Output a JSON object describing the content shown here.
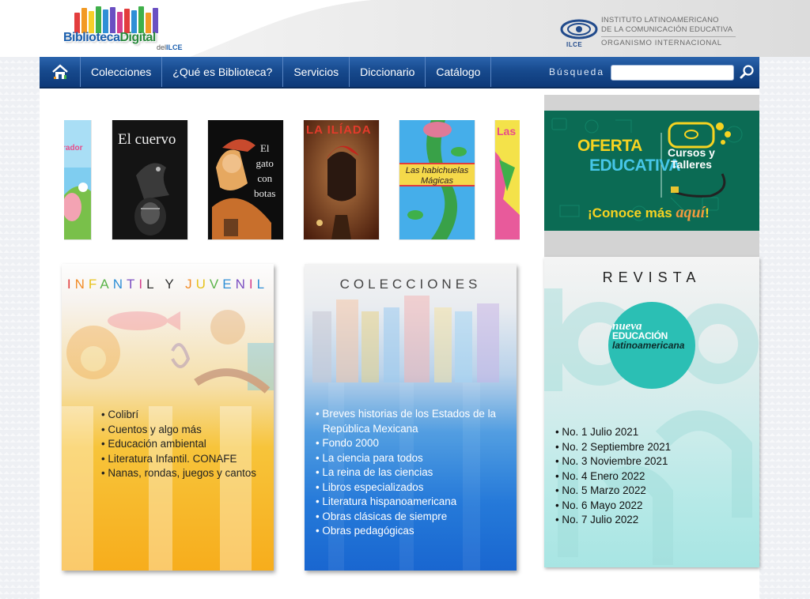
{
  "header": {
    "logo": {
      "word1": "Biblioteca",
      "word2": "Digital",
      "sub_prefix": "del",
      "sub_org": "ILCE"
    },
    "institute": {
      "abbr": "ILCE",
      "line1": "INSTITUTO LATINOAMERICANO",
      "line2": "DE LA COMUNICACIÓN EDUCATIVA",
      "line3": "ORGANISMO INTERNACIONAL"
    }
  },
  "nav": {
    "home_icon": "home-icon",
    "items": [
      {
        "label": "Colecciones"
      },
      {
        "label": "¿Qué es Biblioteca?"
      },
      {
        "label": "Servicios"
      },
      {
        "label": "Diccionario"
      },
      {
        "label": "Catálogo"
      }
    ],
    "search_label": "Búsqueda",
    "search_value": "",
    "search_icon": "search-icon"
  },
  "carousel": {
    "books": [
      {
        "title": "rador",
        "color": "#6cc3e8"
      },
      {
        "title": "El cuervo",
        "color": "#151515"
      },
      {
        "title": "El gato con botas",
        "title_lines": [
          "El",
          "gato",
          "con",
          "botas"
        ],
        "color": "#0e0e0e"
      },
      {
        "title": "LA ILÍADA",
        "color": "#7a2f12"
      },
      {
        "title": "Las habichuelas Mágicas",
        "title_lines": [
          "Las habichuelas",
          "Mágicas"
        ],
        "color": "#3aa3e6"
      },
      {
        "title": "Las",
        "color": "#f4e24a"
      }
    ]
  },
  "oferta": {
    "line1": "OFERTA",
    "line2": "EDUCATIVA",
    "badge1": "Cursos y",
    "badge2": "Talleres",
    "cta_prefix": "¡Conoce más ",
    "cta_highlight": "aquí",
    "cta_suffix": "!"
  },
  "infantil": {
    "title": "INFANTIL Y JUVENIL",
    "title_letter_colors": [
      "#e23b3b",
      "#f28c28",
      "#e7c21c",
      "#5bb44a",
      "#2f8fd6",
      "#7b4fc2",
      "#d43f8d",
      "#333",
      "#333",
      "#333",
      "#e23b3b",
      "#f28c28",
      "#e7c21c",
      "#5bb44a",
      "#2f8fd6",
      "#7b4fc2",
      "#d43f8d",
      "#2f8fd6"
    ],
    "items": [
      "Colibrí",
      "Cuentos y algo más",
      "Educación ambiental",
      "Literatura Infantil. CONAFE",
      "Nanas, rondas, juegos y cantos"
    ]
  },
  "colecciones": {
    "title": "COLECCIONES",
    "items": [
      "Breves historias de los Estados de la República Mexicana",
      "Fondo 2000",
      "La ciencia para todos",
      "La reina de las ciencias",
      "Libros especializados",
      "Literatura hispanoamericana",
      "Obras clásicas de siempre",
      "Obras pedagógicas"
    ]
  },
  "revista": {
    "title": "REVISTA",
    "logo_line1": "nueva",
    "logo_line2": "EDUCACIÓN",
    "logo_line3": "latinoamericana",
    "items": [
      "No. 1 Julio 2021",
      "No. 2 Septiembre 2021",
      "No. 3 Noviembre 2021",
      "No. 4 Enero 2022",
      "No. 5 Marzo 2022",
      "No. 6 Mayo 2022",
      "No. 7 Julio 2022"
    ]
  },
  "colors": {
    "nav_blue": "#174a8e",
    "logo_blue": "#1b5fae",
    "logo_green": "#2a8a3d",
    "oferta_green": "#0b6b54",
    "revista_teal": "#2bbfb4"
  }
}
